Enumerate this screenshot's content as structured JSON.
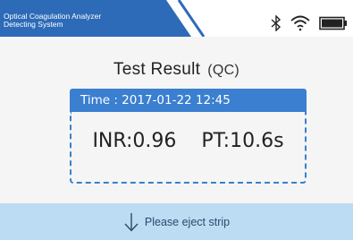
{
  "header": {
    "title_line1": "Optical Coagulation Analyzer",
    "title_line2": "Detecting System",
    "icons": [
      "bluetooth-icon",
      "wifi-icon",
      "battery-icon"
    ]
  },
  "result": {
    "title": "Test Result",
    "mode": "(QC)",
    "time": "Time : 2017-01-22 12:45",
    "inr": "INR:0.96",
    "pt": "PT:10.6s"
  },
  "footer": {
    "icon": "arrow-down-icon",
    "message": "Please eject strip"
  },
  "colors": {
    "accent": "#3a7fd0",
    "header_tab": "#2d6bb8",
    "footer_bg": "#bcdcf4",
    "panel_bg": "#f5f5f5"
  }
}
